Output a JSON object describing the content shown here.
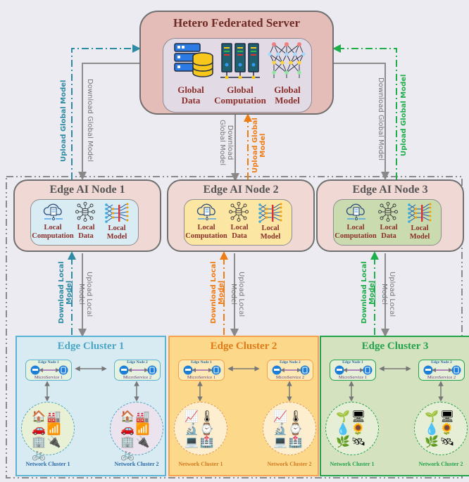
{
  "server": {
    "title": "Hetero Federated Server",
    "items": [
      {
        "icon": "database-server-icon",
        "label_l1": "Global",
        "label_l2": "Data"
      },
      {
        "icon": "server-rack-icon",
        "label_l1": "Global",
        "label_l2": "Computation"
      },
      {
        "icon": "neural-network-icon",
        "label_l1": "Global",
        "label_l2": "Model"
      }
    ]
  },
  "links_global": {
    "upload": "Upload Global Model",
    "download": "Download Global Model",
    "download_l1": "Download",
    "download_l2": "Global Model",
    "upload_l1": "Upload Global",
    "upload_l2": "Model"
  },
  "links_local": {
    "download_l1": "Download Local",
    "download_l2": "Model",
    "upload_l1": "Upload Local",
    "upload_l2": "Model"
  },
  "nodes": [
    {
      "title": "Edge AI Node 1",
      "color": "#d9ebf3",
      "accent": "#2e8ba4"
    },
    {
      "title": "Edge AI Node 2",
      "color": "#fbe6a3",
      "accent": "#ef7d16"
    },
    {
      "title": "Edge AI Node 3",
      "color": "#cadbaf",
      "accent": "#1fae4a"
    }
  ],
  "node_items": [
    {
      "icon": "cloud-server-icon",
      "label_l1": "Local",
      "label_l2": "Computation"
    },
    {
      "icon": "data-hub-icon",
      "label_l1": "Local",
      "label_l2": "Data"
    },
    {
      "icon": "local-model-icon",
      "label_l1": "Local",
      "label_l2": "Model"
    }
  ],
  "clusters": [
    {
      "title": "Edge Cluster 1",
      "bg": "#d8ebf3",
      "border": "#5bb3d3",
      "title_color": "#4aa6c4",
      "enode_bg": "#e6f1df",
      "net_bg_1": "#e8f0d6",
      "net_bg_2": "#ebe4ef",
      "net_border": "#4aa6c4",
      "net_label_color": "#2a6aa6"
    },
    {
      "title": "Edge Cluster 2",
      "bg": "#fbd88a",
      "border": "#f4a04c",
      "title_color": "#e07a18",
      "enode_bg": "#fde9b6",
      "net_bg_1": "#fdeed0",
      "net_bg_2": "#fdeed0",
      "net_border": "#e69a4a",
      "net_label_color": "#d27a20"
    },
    {
      "title": "Edge Cluster 3",
      "bg": "#d4e2c0",
      "border": "#23a24b",
      "title_color": "#23a24b",
      "enode_bg": "#e6efd8",
      "net_bg_1": "#e6eed6",
      "net_bg_2": "#e6eed6",
      "net_border": "#23a24b",
      "net_label_color": "#23a24b"
    }
  ],
  "edge_nodes": [
    {
      "title": "Edge Node 1",
      "service": "MicroService 1"
    },
    {
      "title": "Edge Node 2",
      "service": "MicroService 2"
    }
  ],
  "network_clusters": [
    "Network Cluster 1",
    "Network Cluster 2"
  ]
}
